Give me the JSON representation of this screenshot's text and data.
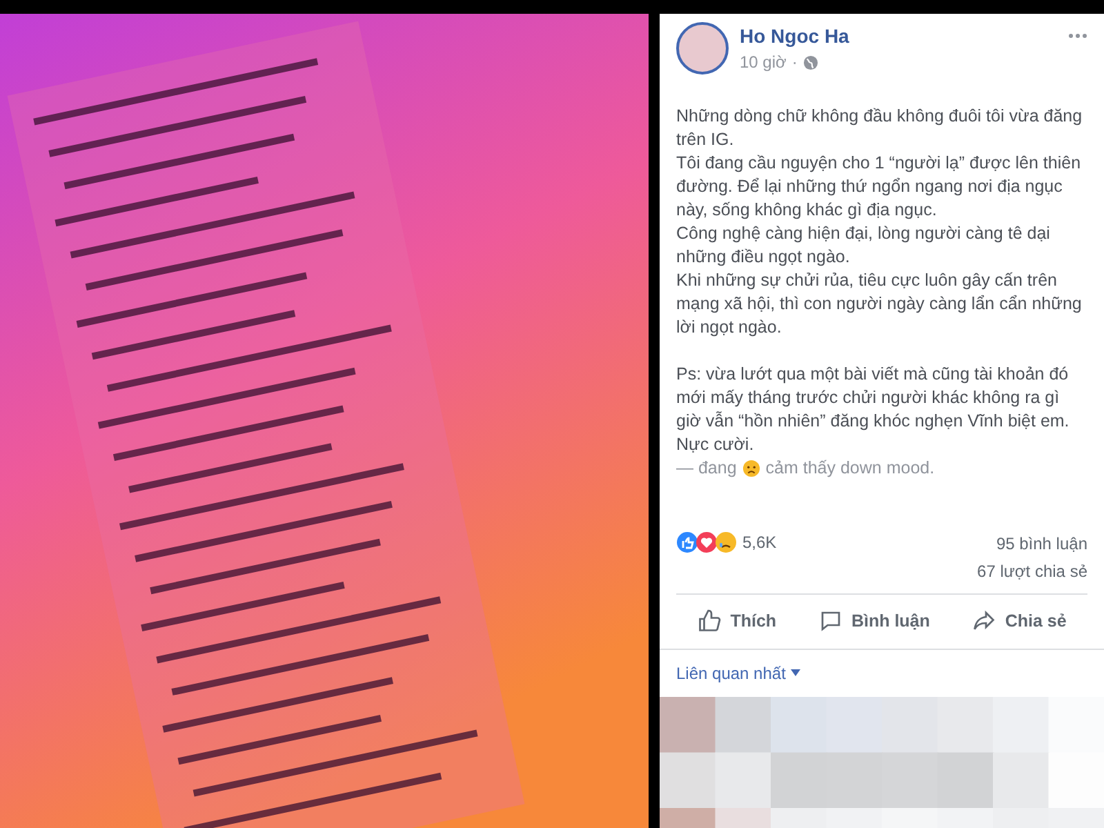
{
  "photo": {
    "kind": "picture"
  },
  "post": {
    "author": "Ho Ngoc Ha",
    "time": "10 giờ",
    "separator": "·",
    "paragraphs": [
      "Những dòng chữ không đầu không đuôi tôi vừa đăng trên IG.\nTôi đang cầu nguyện cho 1 “người lạ” được lên thiên đường. Để lại những thứ ngổn ngang nơi địa ngục này, sống không khác gì địa ngục.\nCông nghệ càng hiện đại, lòng người càng tê dại những điều ngọt ngào.\nKhi những sự chửi rủa, tiêu cực luôn gây cấn trên mạng xã hội, thì con người ngày càng lẩn cẩn những lời ngọt ngào.",
      "Ps: vừa lướt qua một bài viết mà cũng tài khoản đó mới mấy tháng trước chửi người khác không ra gì giờ vẫn “hồn nhiên” đăng khóc nghẹn Vĩnh biệt em. Nực cười."
    ],
    "feeling": {
      "prefix": "— đang",
      "text": "cảm thấy down mood."
    },
    "reactions": {
      "count": "5,6K"
    },
    "comments": "95 bình luận",
    "shares": "67 lượt chia sẻ",
    "actions": [
      {
        "kind": "like",
        "label": "Thích"
      },
      {
        "kind": "comment",
        "label": "Bình luận"
      },
      {
        "kind": "share",
        "label": "Chia sẻ"
      }
    ],
    "sort": "Liên quan nhất",
    "comments_preview": {
      "kind": "picture"
    }
  }
}
